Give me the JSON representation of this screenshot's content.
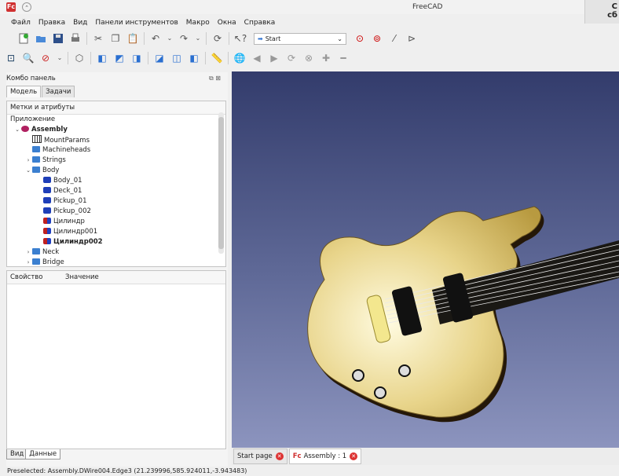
{
  "window": {
    "title": "FreeCAD",
    "notification": "С\nсб"
  },
  "menubar": [
    "Файл",
    "Правка",
    "Вид",
    "Панели инструментов",
    "Макро",
    "Окна",
    "Справка"
  ],
  "toolbar1": {
    "macro_select": "Start"
  },
  "combo": {
    "title": "Комбо панель",
    "tabs": [
      "Модель",
      "Задачи"
    ],
    "tree_header": "Метки и атрибуты",
    "tree": [
      {
        "label": "Приложение",
        "indent": 0,
        "toggle": "",
        "icon": "",
        "bold": false
      },
      {
        "label": "Assembly",
        "indent": 1,
        "toggle": "⌄",
        "icon": "asm",
        "bold": true
      },
      {
        "label": "MountParams",
        "indent": 2,
        "toggle": "",
        "icon": "grid",
        "bold": false
      },
      {
        "label": "Machineheads",
        "indent": 2,
        "toggle": "",
        "icon": "folder",
        "bold": false
      },
      {
        "label": "Strings",
        "indent": 2,
        "toggle": "›",
        "icon": "folder",
        "bold": false
      },
      {
        "label": "Body",
        "indent": 2,
        "toggle": "⌄",
        "icon": "folder",
        "bold": false
      },
      {
        "label": "Body_01",
        "indent": 3,
        "toggle": "",
        "icon": "part",
        "bold": false
      },
      {
        "label": "Deck_01",
        "indent": 3,
        "toggle": "",
        "icon": "part",
        "bold": false
      },
      {
        "label": "Pickup_01",
        "indent": 3,
        "toggle": "",
        "icon": "part",
        "bold": false
      },
      {
        "label": "Pickup_002",
        "indent": 3,
        "toggle": "",
        "icon": "part",
        "bold": false
      },
      {
        "label": "Цилиндр",
        "indent": 3,
        "toggle": "",
        "icon": "cyl",
        "bold": false
      },
      {
        "label": "Цилиндр001",
        "indent": 3,
        "toggle": "",
        "icon": "cyl",
        "bold": false
      },
      {
        "label": "Цилиндр002",
        "indent": 3,
        "toggle": "",
        "icon": "cyl",
        "bold": true
      },
      {
        "label": "Neck",
        "indent": 2,
        "toggle": "›",
        "icon": "folder",
        "bold": false
      },
      {
        "label": "Bridge",
        "indent": 2,
        "toggle": "›",
        "icon": "folder",
        "bold": false
      }
    ],
    "props_header": {
      "property": "Свойство",
      "value": "Значение"
    },
    "bottom_tabs": [
      "Вид",
      "Данные"
    ]
  },
  "doc_tabs": [
    {
      "label": "Start page",
      "active": false
    },
    {
      "label": "Assembly : 1",
      "active": true
    }
  ],
  "status": "Preselected: Assembly.DWire004.Edge3 (21.239996,585.924011,-3.943483)",
  "colors": {
    "accent": "#d03030",
    "viewport_top": "#333c6c",
    "viewport_bottom": "#8c94be",
    "guitar_body": "#e8d48a"
  }
}
